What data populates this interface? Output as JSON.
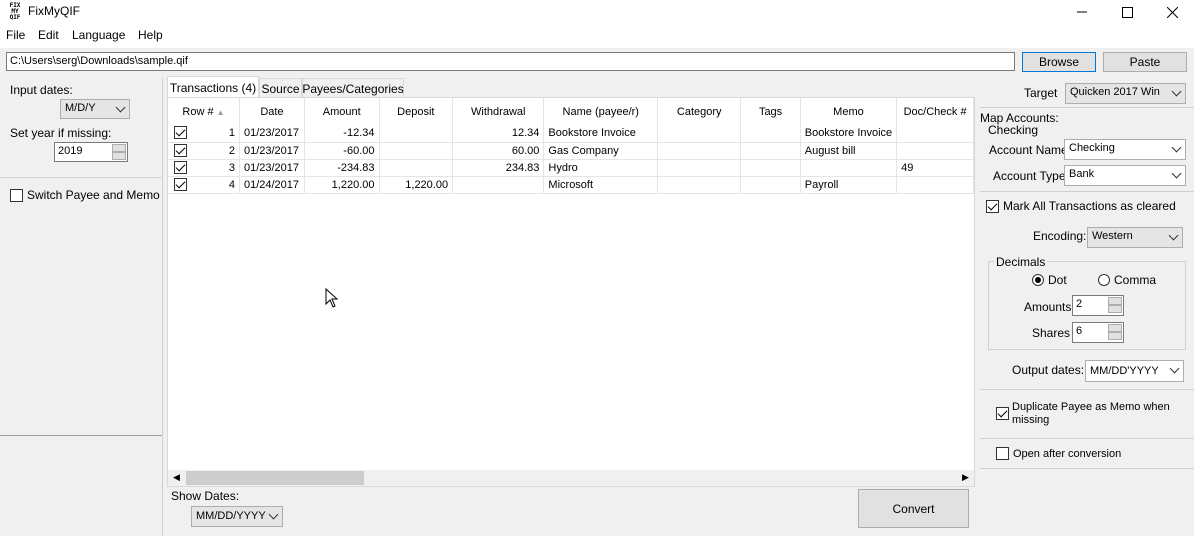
{
  "window": {
    "title": "FixMyQIF",
    "icon_text": "FIX\nMY\nQIF",
    "controls": [
      "minimize",
      "maximize",
      "close"
    ]
  },
  "menu": [
    "File",
    "Edit",
    "Language",
    "Help"
  ],
  "path": {
    "value": "C:\\Users\\serg\\Downloads\\sample.qif",
    "browse_label": "Browse",
    "paste_label": "Paste"
  },
  "left": {
    "input_dates_label": "Input dates:",
    "input_dates_value": "M/D/Y",
    "year_label": "Set year if missing:",
    "year_value": "2019",
    "switch_label": "Switch Payee and Memo",
    "switch_checked": false
  },
  "tabs": [
    "Transactions (4)",
    "Source",
    "Payees/Categories"
  ],
  "grid": {
    "columns": [
      "Row #",
      "Date",
      "Amount",
      "Deposit",
      "Withdrawal",
      "Name (payee/r)",
      "Category",
      "Tags",
      "Memo",
      "Doc/Check #"
    ],
    "rows": [
      {
        "checked": true,
        "row": "1",
        "date": "01/23/2017",
        "amount": "-12.34",
        "deposit": "",
        "withdrawal": "12.34",
        "name": "Bookstore Invoice",
        "category": "",
        "tags": "",
        "memo": "Bookstore Invoice",
        "doc": ""
      },
      {
        "checked": true,
        "row": "2",
        "date": "01/23/2017",
        "amount": "-60.00",
        "deposit": "",
        "withdrawal": "60.00",
        "name": "Gas Company",
        "category": "",
        "tags": "",
        "memo": "August bill",
        "doc": ""
      },
      {
        "checked": true,
        "row": "3",
        "date": "01/23/2017",
        "amount": "-234.83",
        "deposit": "",
        "withdrawal": "234.83",
        "name": "Hydro",
        "category": "",
        "tags": "",
        "memo": "",
        "doc": "49"
      },
      {
        "checked": true,
        "row": "4",
        "date": "01/24/2017",
        "amount": "1,220.00",
        "deposit": "1,220.00",
        "withdrawal": "",
        "name": "Microsoft",
        "category": "",
        "tags": "",
        "memo": "Payroll",
        "doc": ""
      }
    ]
  },
  "bottom": {
    "show_dates_label": "Show Dates:",
    "show_dates_value": "MM/DD/YYYY",
    "convert_label": "Convert"
  },
  "right": {
    "target_label": "Target",
    "target_value": "Quicken 2017 Win",
    "map_accounts_label": "Map Accounts:",
    "checking_label": "Checking",
    "account_name_label": "Account Name:",
    "account_name_value": "Checking",
    "account_type_label": "Account Type:",
    "account_type_value": "Bank",
    "mark_cleared_label": "Mark All Transactions as cleared",
    "mark_cleared_checked": true,
    "encoding_label": "Encoding:",
    "encoding_value": "Western",
    "decimals_label": "Decimals",
    "dot_label": "Dot",
    "comma_label": "Comma",
    "decimal_selected": "Dot",
    "amounts_label": "Amounts",
    "amounts_value": "2",
    "shares_label": "Shares",
    "shares_value": "6",
    "output_dates_label": "Output dates:",
    "output_dates_value": "MM/DD'YYYY",
    "duplicate_label_1": "Duplicate Payee as Memo when",
    "duplicate_label_2": "missing",
    "duplicate_checked": true,
    "open_after_label": "Open after conversion",
    "open_after_checked": false
  }
}
